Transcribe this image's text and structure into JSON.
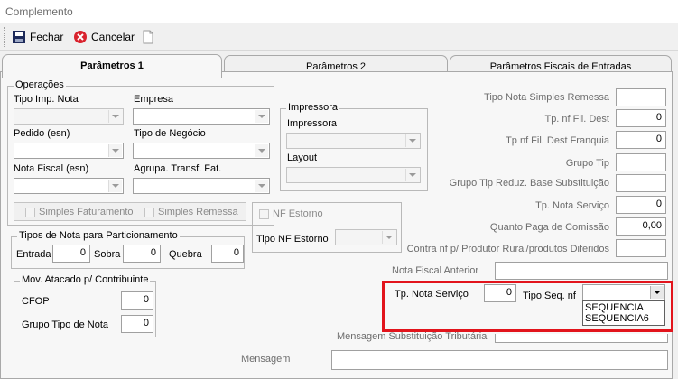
{
  "window": {
    "title": "Complemento"
  },
  "toolbar": {
    "fechar": "Fechar",
    "cancelar": "Cancelar"
  },
  "tabs": [
    "Parâmetros 1",
    "Parâmetros 2",
    "Parâmetros Fiscais de Entradas"
  ],
  "operacoes": {
    "title": "Operações",
    "tipo_imp_nota": "Tipo Imp. Nota",
    "empresa": "Empresa",
    "pedido": "Pedido (esn)",
    "tipo_negocio": "Tipo de Negócio",
    "nota_fiscal": "Nota Fiscal (esn)",
    "agrupa": "Agrupa. Transf. Fat.",
    "simples_faturamento": "Simples Faturamento",
    "simples_remessa": "Simples Remessa"
  },
  "impressora": {
    "title": "Impressora",
    "impressora": "Impressora",
    "layout": "Layout"
  },
  "nf_estorno": {
    "label": "NF Estorno",
    "tipo": "Tipo NF Estorno"
  },
  "tipos_nota": {
    "title": "Tipos de Nota para Particionamento",
    "entrada": "Entrada",
    "entrada_val": "0",
    "sobra": "Sobra",
    "sobra_val": "0",
    "quebra": "Quebra",
    "quebra_val": "0"
  },
  "mov_atacado": {
    "title": "Mov. Atacado p/ Contribuinte",
    "cfop": "CFOP",
    "cfop_val": "0",
    "grupo": "Grupo Tipo de Nota",
    "grupo_val": "0"
  },
  "right_fields": {
    "tipo_nota_simples_remessa": "Tipo Nota Simples Remessa",
    "tp_nf_fil_dest": "Tp. nf Fil. Dest",
    "tp_nf_fil_dest_val": "0",
    "tp_nf_fil_dest_franquia": "Tp nf Fil. Dest Franquia",
    "tp_nf_fil_dest_franquia_val": "0",
    "grupo_tip": "Grupo Tip",
    "grupo_tip_reduz": "Grupo Tip Reduz. Base Substituição",
    "tp_nota_servico": "Tp. Nota Serviço",
    "tp_nota_servico_val": "0",
    "quanto_paga": "Quanto Paga de Comissão",
    "quanto_paga_val": "0,00",
    "contra_nf": "Contra nf p/ Produtor Rural/produtos Diferidos"
  },
  "nota_fiscal_anterior": "Nota Fiscal Anterior",
  "highlight": {
    "tp_nota_servico": "Tp. Nota Serviço",
    "tp_nota_servico_val": "0",
    "tipo_seq_nf": "Tipo Seq. nf",
    "options": [
      "SEQUENCIA",
      "SEQUENCIA6"
    ]
  },
  "mensagem_subst": "Mensagem Substituição Tributária",
  "mensagem": "Mensagem",
  "colors": {
    "highlight": "#e2141c",
    "cancel": "#d9232e"
  }
}
